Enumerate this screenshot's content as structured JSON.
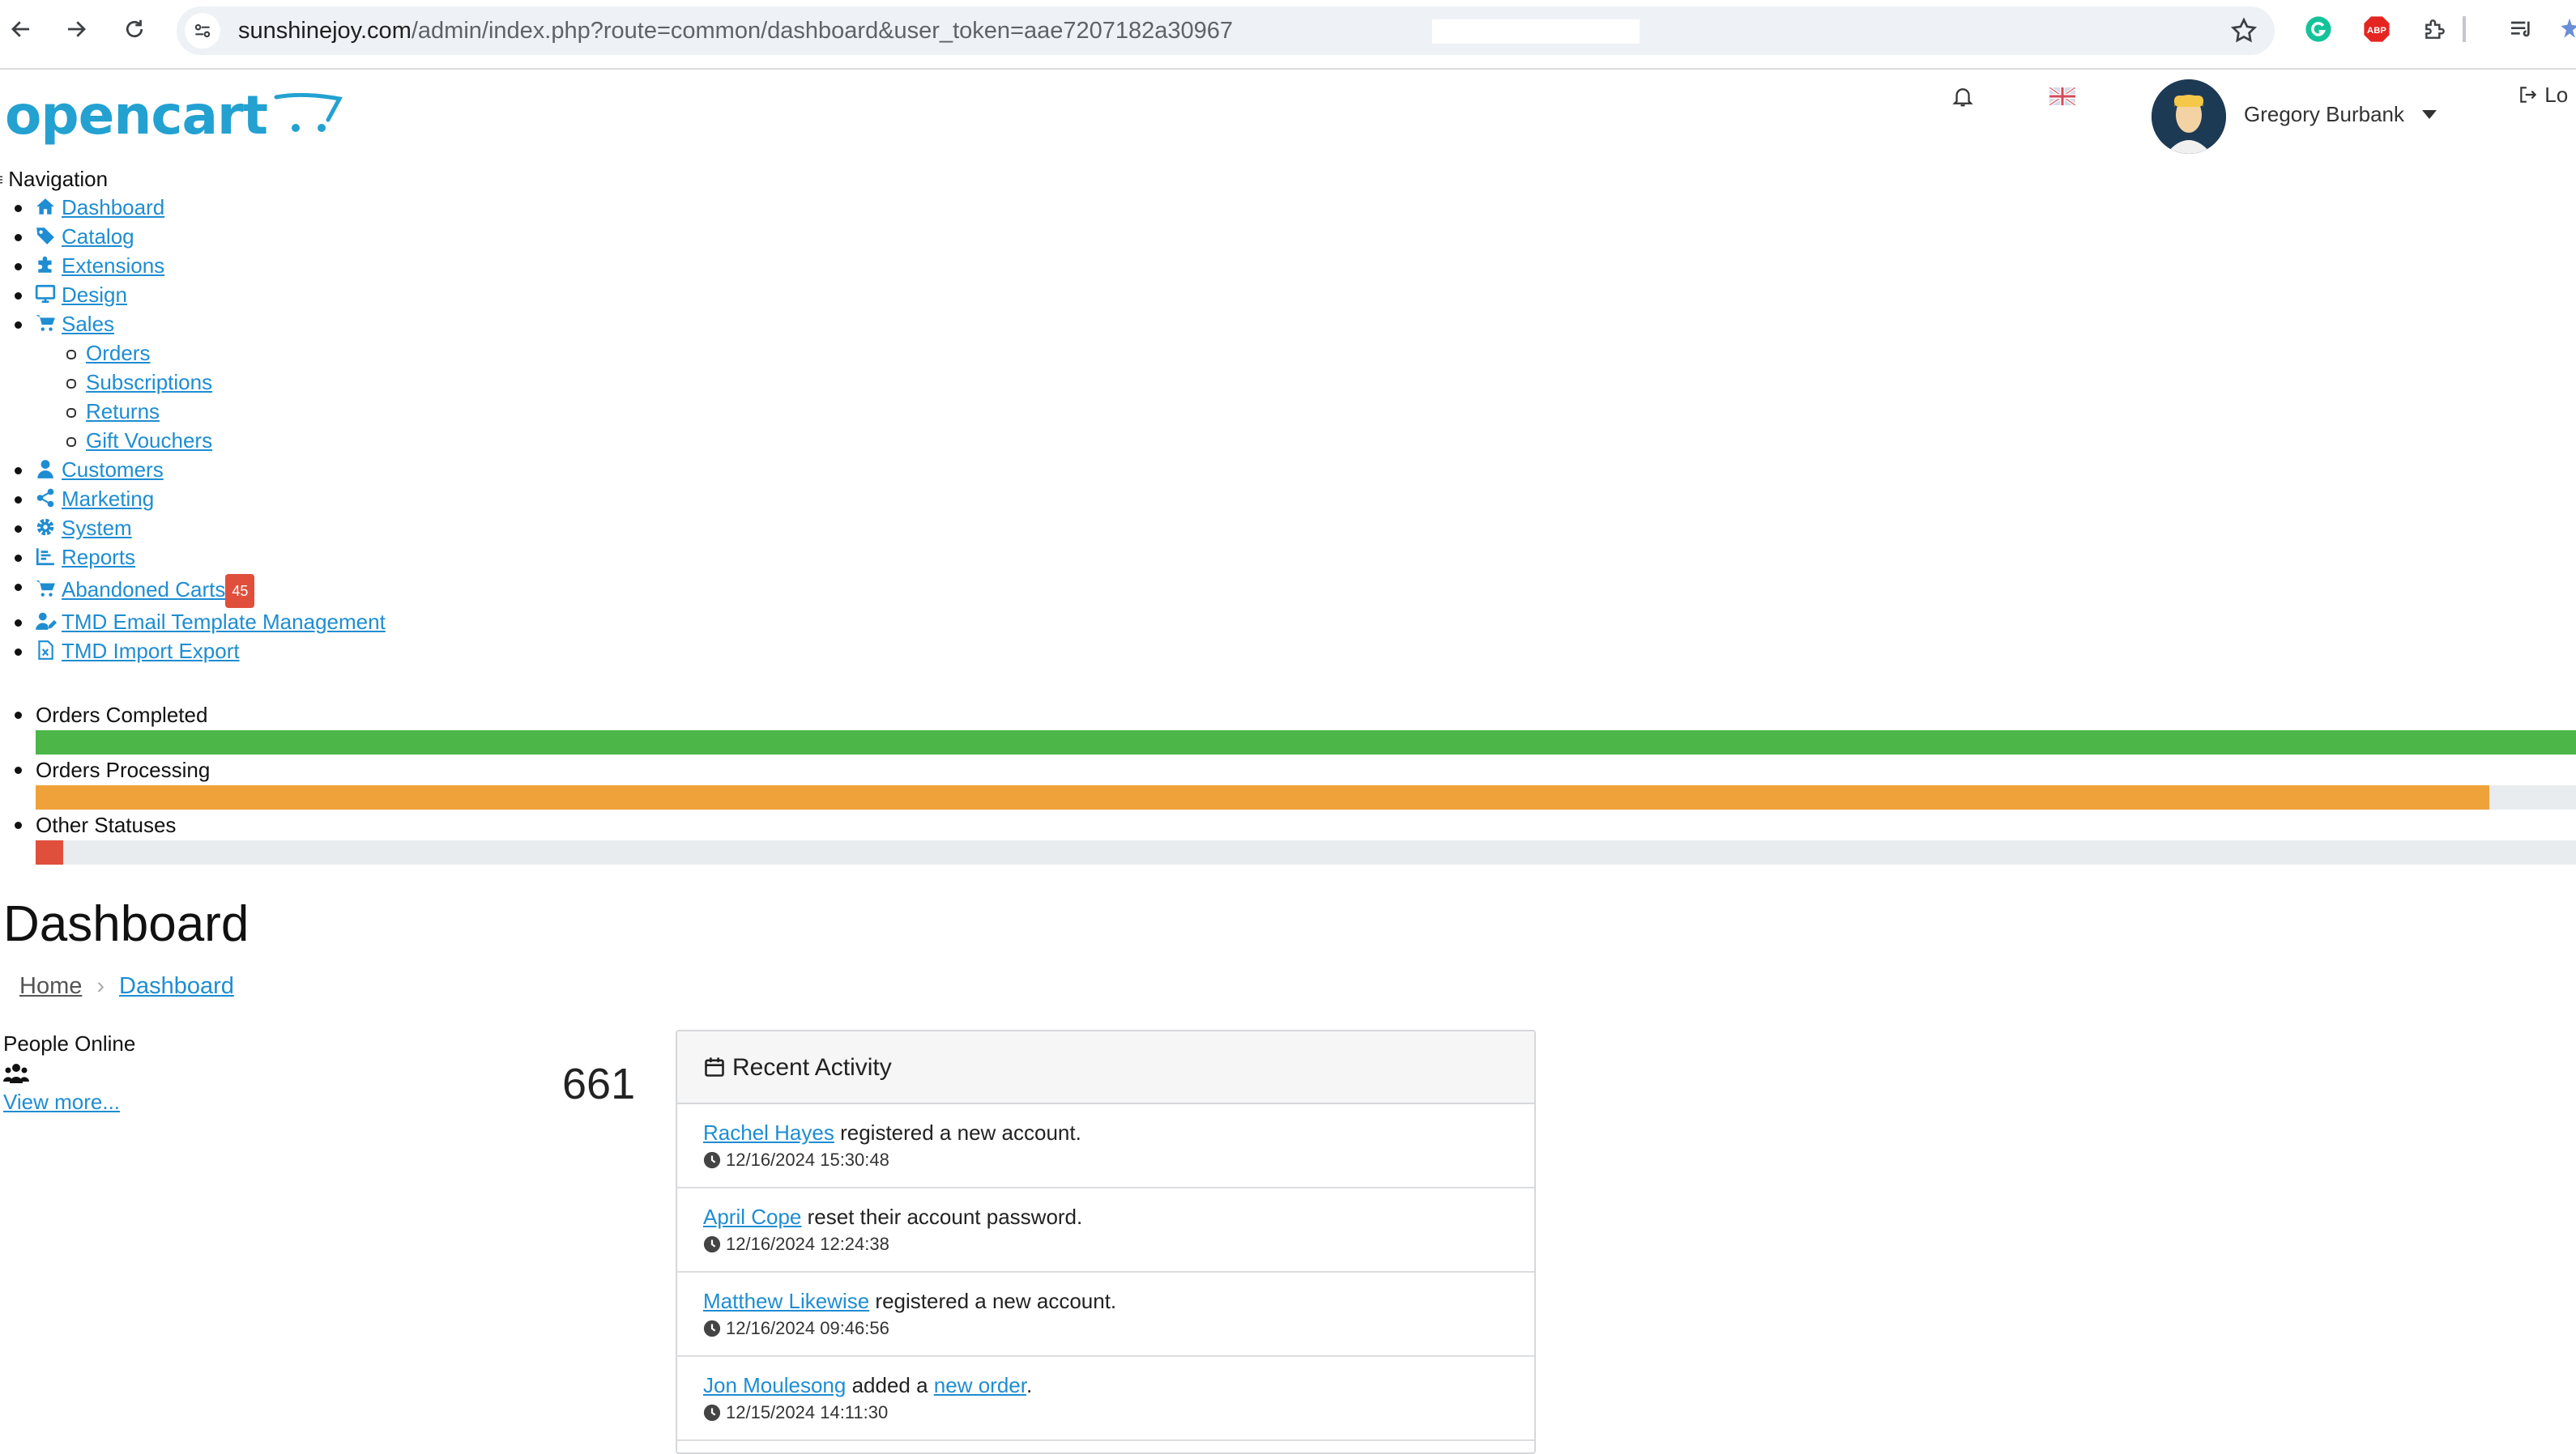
{
  "browser": {
    "url_host": "sunshinejoy.com",
    "url_path": "/admin/index.php?route=common/dashboard&user_token=aae7207182a30967"
  },
  "header": {
    "logo_text": "opencart",
    "user_name": "Gregory Burbank",
    "logout_label": "Lo"
  },
  "nav": {
    "title": "Navigation",
    "items": [
      {
        "label": "Dashboard",
        "icon": "home-icon"
      },
      {
        "label": "Catalog",
        "icon": "tag-icon"
      },
      {
        "label": "Extensions",
        "icon": "puzzle-icon"
      },
      {
        "label": "Design",
        "icon": "monitor-icon"
      },
      {
        "label": "Sales",
        "icon": "cart-icon"
      },
      {
        "label": "Orders"
      },
      {
        "label": "Subscriptions"
      },
      {
        "label": "Returns"
      },
      {
        "label": "Gift Vouchers"
      },
      {
        "label": "Customers",
        "icon": "user-icon"
      },
      {
        "label": "Marketing",
        "icon": "share-icon"
      },
      {
        "label": "System",
        "icon": "gear-icon"
      },
      {
        "label": "Reports",
        "icon": "chart-bar-icon"
      },
      {
        "label": "Abandoned Carts",
        "icon": "cart-icon",
        "badge": "45"
      },
      {
        "label": "TMD Email Template Management",
        "icon": "user-pen-icon"
      },
      {
        "label": "TMD Import Export",
        "icon": "file-excel-icon"
      }
    ]
  },
  "order_status": [
    {
      "label": "Orders Completed",
      "fraction": 1.0,
      "color": "#4cb648"
    },
    {
      "label": "Orders Processing",
      "fraction": 0.966,
      "color": "#f0a23a"
    },
    {
      "label": "Other Statuses",
      "fraction": 0.011,
      "color": "#e04f3c"
    }
  ],
  "page": {
    "title": "Dashboard",
    "breadcrumb": [
      "Home",
      "Dashboard"
    ]
  },
  "people_online": {
    "label": "People Online",
    "value": "661",
    "link": "View more..."
  },
  "activity": {
    "title": "Recent Activity",
    "items": [
      {
        "name": "Rachel Hayes",
        "text": " registered a new account.",
        "time": "12/16/2024 15:30:48"
      },
      {
        "name": "April Cope",
        "text": " reset their account password.",
        "time": "12/16/2024 12:24:38"
      },
      {
        "name": "Matthew Likewise",
        "text": " registered a new account.",
        "time": "12/16/2024 09:46:56"
      },
      {
        "name": "Jon Moulesong",
        "text": " added a ",
        "link": "new order",
        "tail": ".",
        "time": "12/15/2024 14:11:30"
      }
    ]
  },
  "colors": {
    "link": "#1e8dd1",
    "brand": "#23a1d1",
    "badge": "#e04f3c"
  }
}
